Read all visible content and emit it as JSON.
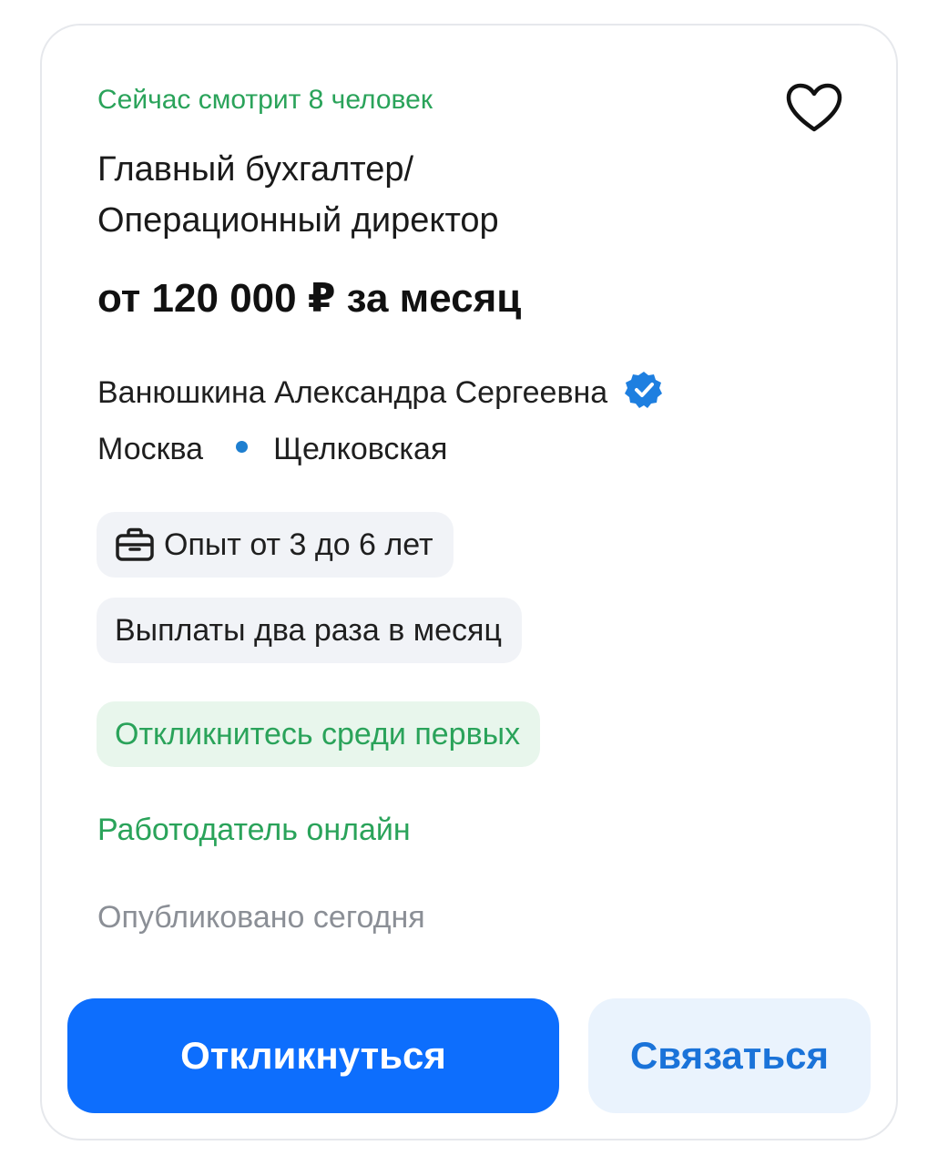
{
  "vacancy": {
    "viewers_text": "Сейчас смотрит 8 человек",
    "title_line1": "Главный бухгалтер/",
    "title_line2": "Операционный директор",
    "salary": "от 120 000 ₽ за месяц",
    "employer_name": "Ванюшкина Александра Сергеевна",
    "employer_verified_icon": "verified-badge-icon",
    "city": "Москва",
    "metro_station": "Щелковская",
    "metro_color": "#1e7fd0",
    "experience_chip": "Опыт от 3 до 6 лет",
    "experience_icon": "briefcase-icon",
    "payment_chip": "Выплаты два раза в месяц",
    "early_response_chip": "Откликнитесь среди первых",
    "employer_online": "Работодатель онлайн",
    "published": "Опубликовано сегодня",
    "favorite_icon": "heart-icon"
  },
  "actions": {
    "respond_label": "Откликнуться",
    "contact_label": "Связаться"
  },
  "colors": {
    "accent_green": "#2aa35a",
    "primary_blue": "#0d6efd",
    "secondary_button_bg": "#eaf3fd",
    "secondary_button_text": "#1a73d9",
    "chip_bg": "#f1f3f7",
    "chip_green_bg": "#e8f6ec",
    "muted_text": "#8b8f96"
  }
}
